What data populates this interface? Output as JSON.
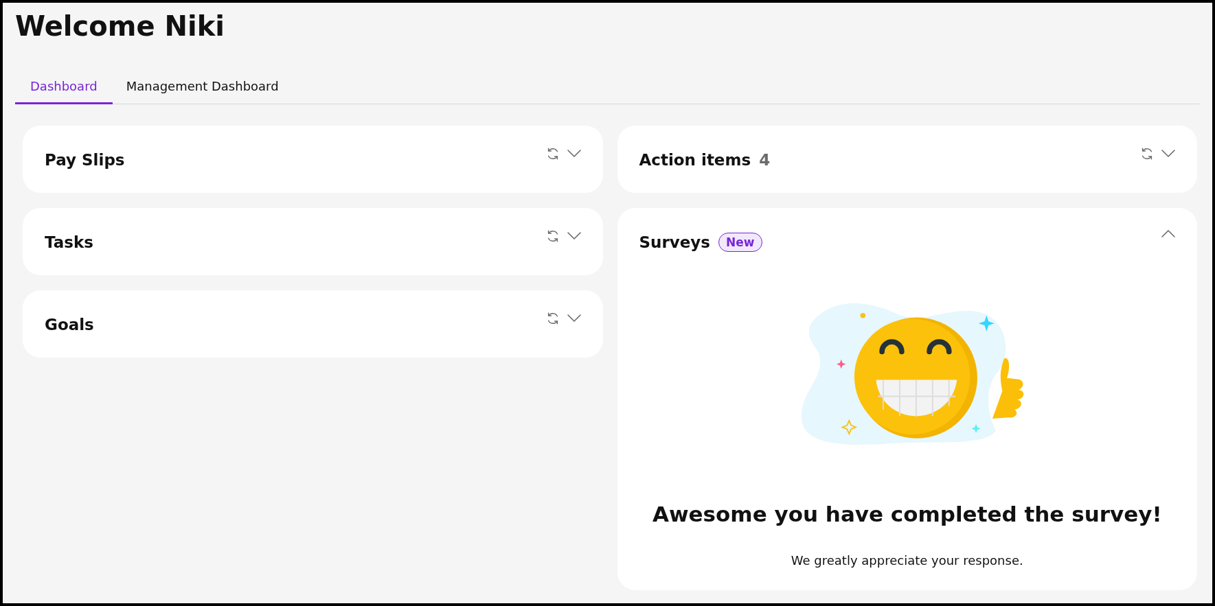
{
  "page_title": "Welcome Niki",
  "tabs": [
    {
      "label": "Dashboard",
      "selected": true
    },
    {
      "label": "Management Dashboard",
      "selected": false
    }
  ],
  "left_cards": [
    {
      "title": "Pay Slips",
      "expanded": false,
      "refresh": true
    },
    {
      "title": "Tasks",
      "expanded": false,
      "refresh": true
    },
    {
      "title": "Goals",
      "expanded": false,
      "refresh": true
    }
  ],
  "right_cards": [
    {
      "title": "Action items",
      "count": "4",
      "expanded": false,
      "refresh": true
    },
    {
      "title": "Surveys",
      "badge": "New",
      "expanded": true,
      "refresh": false,
      "message": {
        "heading": "Awesome you have completed the survey!",
        "text": "We greatly appreciate your response."
      }
    }
  ]
}
